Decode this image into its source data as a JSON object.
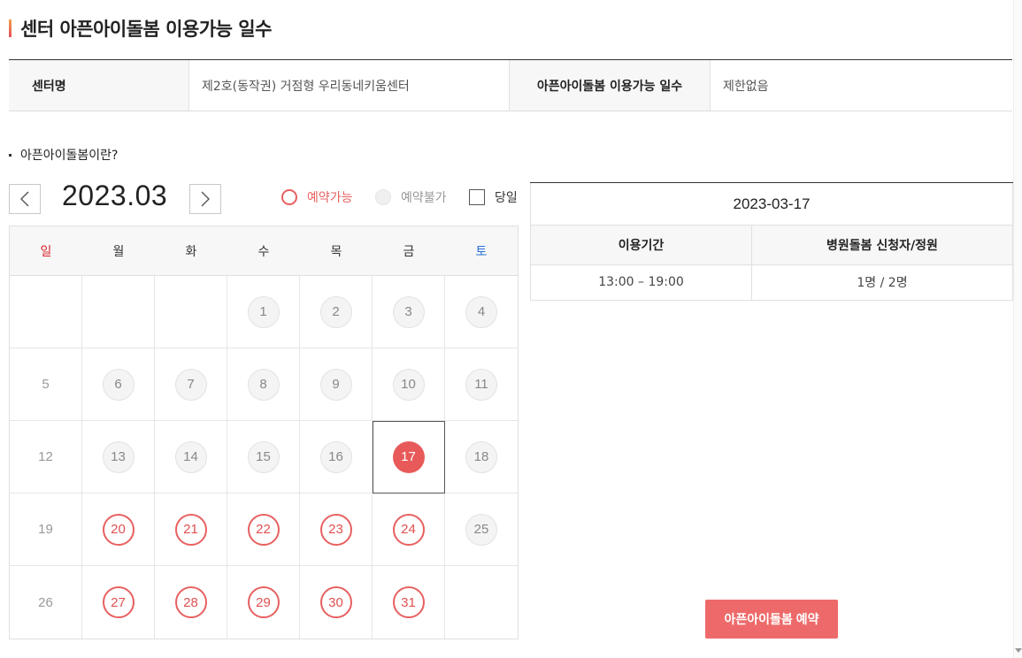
{
  "page": {
    "title": "센터 아픈아이돌봄 이용가능 일수"
  },
  "info": {
    "center_label": "센터명",
    "center_value": "제2호(동작권) 거점형 우리동네키움센터",
    "days_label": "아픈아이돌봄 이용가능 일수",
    "days_value": "제한없음"
  },
  "what_link": "아픈아이돌봄이란?",
  "calendar": {
    "month": "2023.03",
    "legend": {
      "available": "예약가능",
      "unavailable": "예약불가",
      "today": "당일"
    },
    "weekdays": [
      "일",
      "월",
      "화",
      "수",
      "목",
      "금",
      "토"
    ],
    "selected_day": 17,
    "days": [
      {
        "n": "",
        "s": "empty"
      },
      {
        "n": "",
        "s": "empty"
      },
      {
        "n": "",
        "s": "empty"
      },
      {
        "n": "1",
        "s": "unavail"
      },
      {
        "n": "2",
        "s": "unavail"
      },
      {
        "n": "3",
        "s": "unavail"
      },
      {
        "n": "4",
        "s": "unavail"
      },
      {
        "n": "5",
        "s": "plain"
      },
      {
        "n": "6",
        "s": "unavail"
      },
      {
        "n": "7",
        "s": "unavail"
      },
      {
        "n": "8",
        "s": "unavail"
      },
      {
        "n": "9",
        "s": "unavail"
      },
      {
        "n": "10",
        "s": "unavail"
      },
      {
        "n": "11",
        "s": "unavail"
      },
      {
        "n": "12",
        "s": "plain"
      },
      {
        "n": "13",
        "s": "unavail"
      },
      {
        "n": "14",
        "s": "unavail"
      },
      {
        "n": "15",
        "s": "unavail"
      },
      {
        "n": "16",
        "s": "unavail"
      },
      {
        "n": "17",
        "s": "selected"
      },
      {
        "n": "18",
        "s": "unavail"
      },
      {
        "n": "19",
        "s": "plain"
      },
      {
        "n": "20",
        "s": "avail"
      },
      {
        "n": "21",
        "s": "avail"
      },
      {
        "n": "22",
        "s": "avail"
      },
      {
        "n": "23",
        "s": "avail"
      },
      {
        "n": "24",
        "s": "avail"
      },
      {
        "n": "25",
        "s": "unavail"
      },
      {
        "n": "26",
        "s": "plain"
      },
      {
        "n": "27",
        "s": "avail"
      },
      {
        "n": "28",
        "s": "avail"
      },
      {
        "n": "29",
        "s": "avail"
      },
      {
        "n": "30",
        "s": "avail"
      },
      {
        "n": "31",
        "s": "avail"
      },
      {
        "n": "",
        "s": "empty"
      }
    ]
  },
  "detail": {
    "date": "2023-03-17",
    "col_period": "이용기간",
    "col_applicants": "병원돌봄 신청자/정원",
    "period": "13:00 – 19:00",
    "applicants": "1명 / 2명"
  },
  "reserve_button": "아픈아이돌봄 예약",
  "colors": {
    "accent": "#e86060",
    "button": "#ee6a6a",
    "sunday": "#d7262b",
    "saturday": "#2a6fd6"
  }
}
